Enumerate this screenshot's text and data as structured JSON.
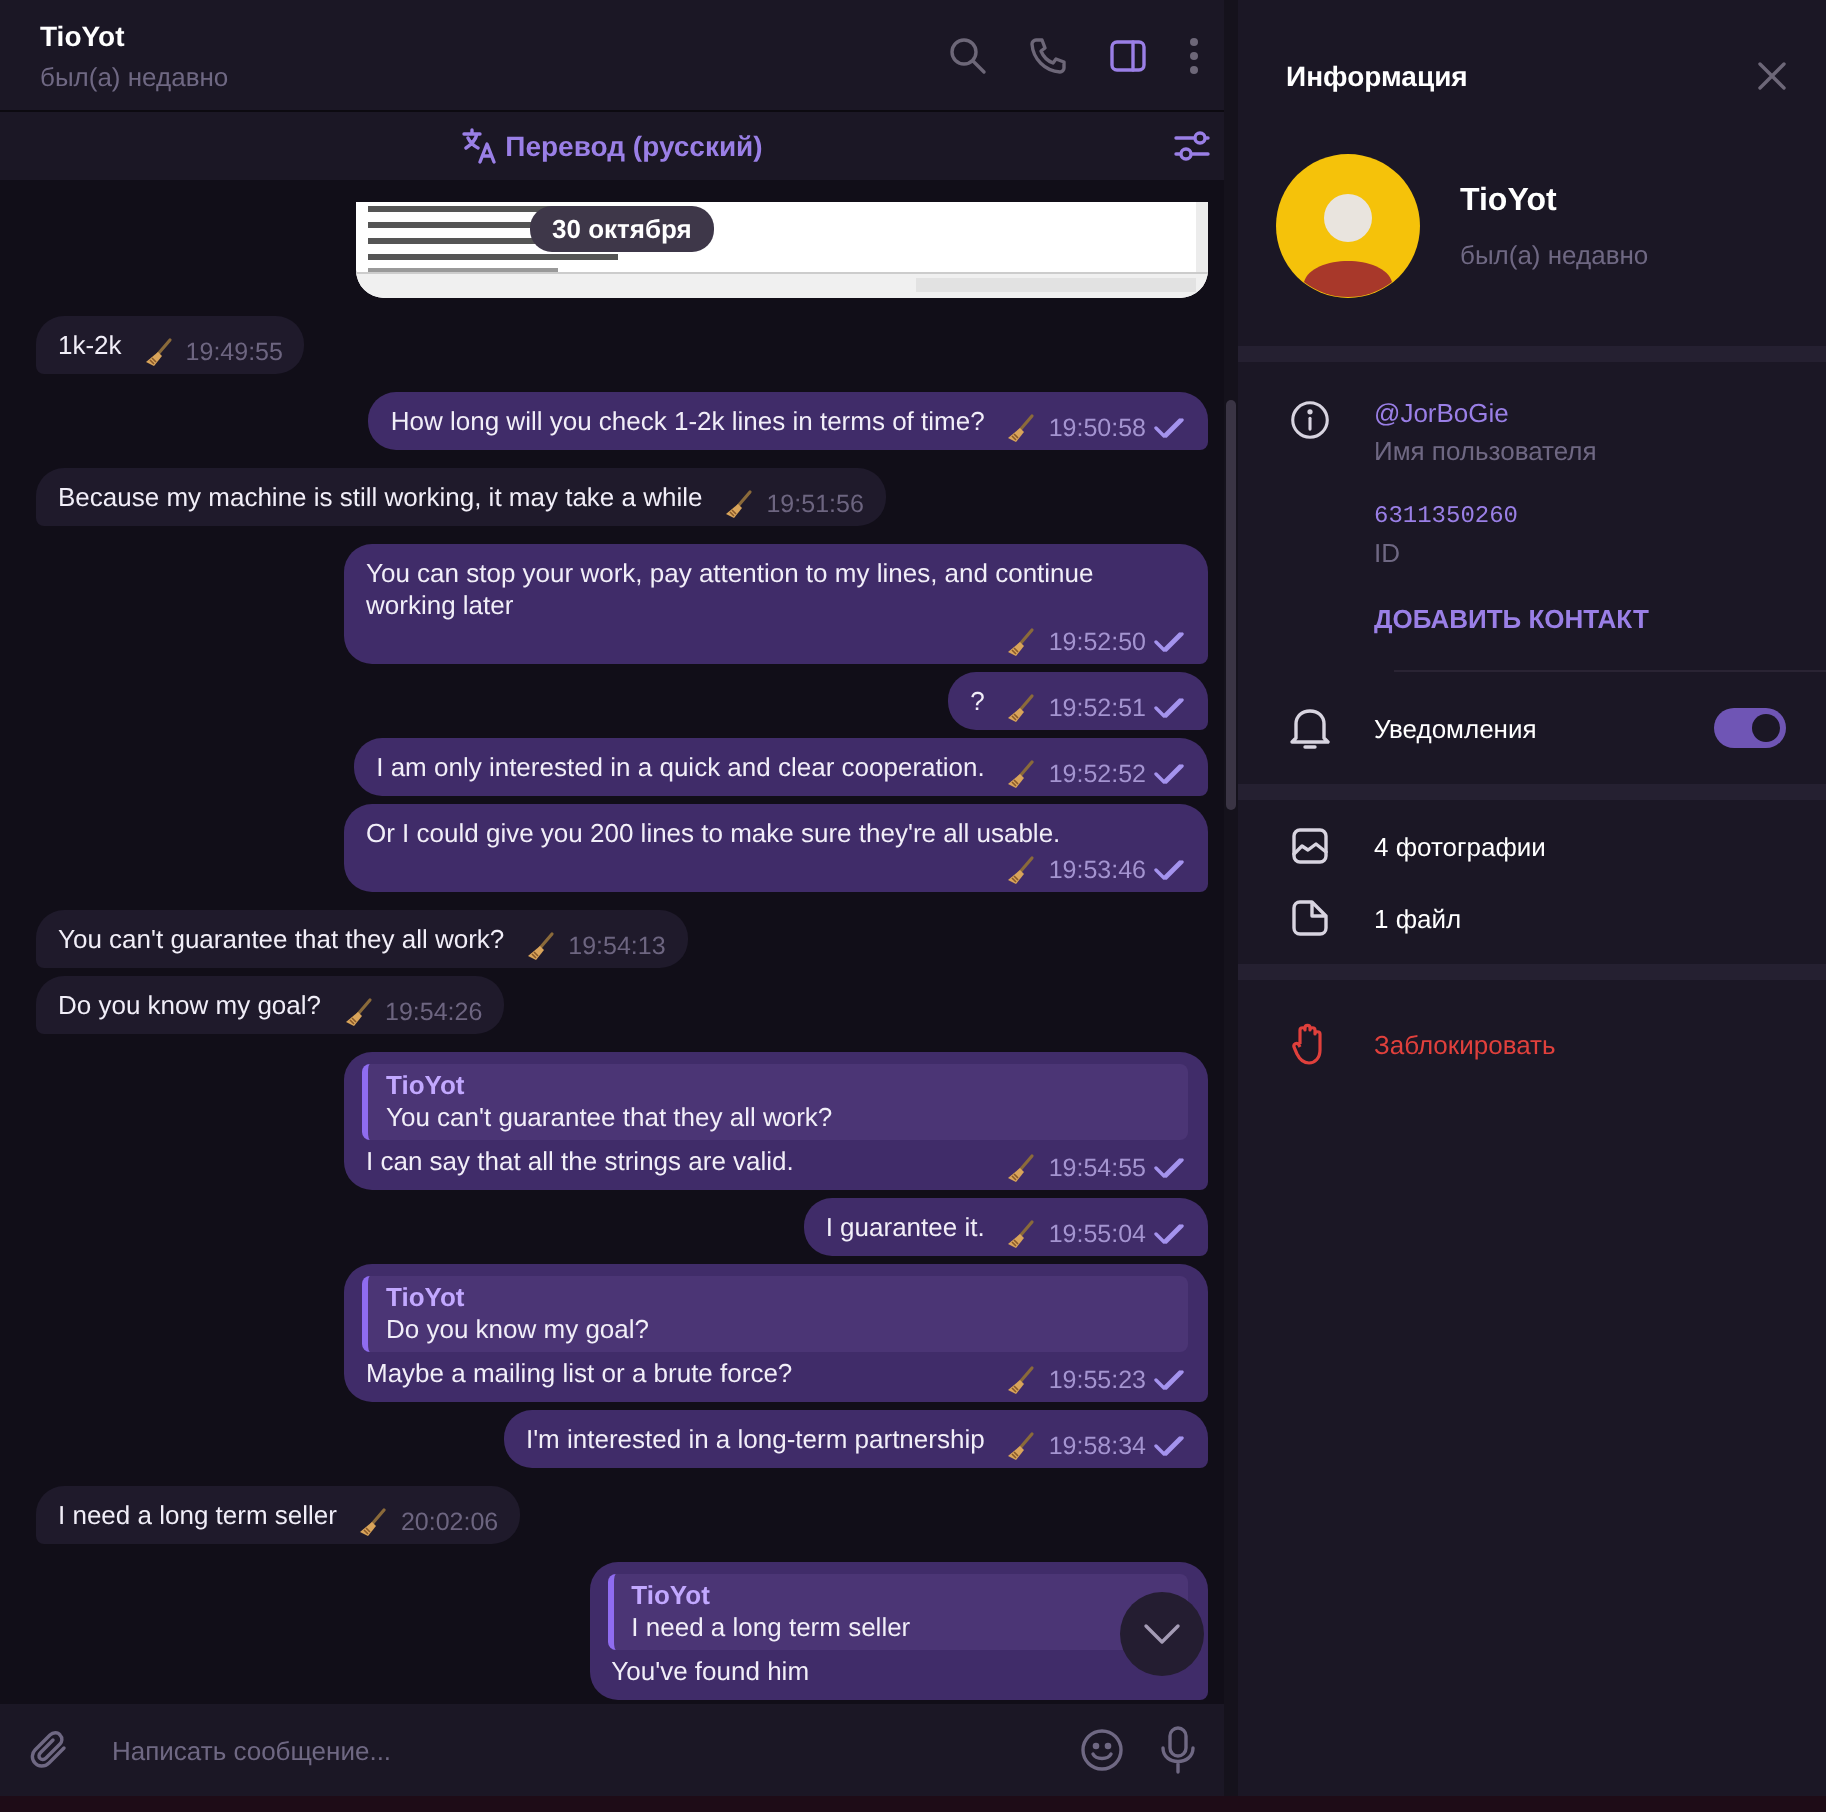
{
  "chat_header": {
    "title": "TioYot",
    "status": "был(а) недавно",
    "panel_toggle_on": true
  },
  "translate_bar": {
    "label": "Перевод (русский)"
  },
  "date_pill": "30 октября",
  "messages": [
    {
      "kind": "picture",
      "outgoing": true
    },
    {
      "kind": "text",
      "outgoing": false,
      "text": "1k-2k",
      "time": "19:49:55"
    },
    {
      "kind": "text",
      "outgoing": true,
      "text": "How long will you check 1-2k lines in terms of time?",
      "time": "19:50:58",
      "read": true
    },
    {
      "kind": "text",
      "outgoing": false,
      "text": "Because my machine is still working, it may take a while",
      "time": "19:51:56"
    },
    {
      "kind": "text",
      "outgoing": true,
      "text": "You can stop your work, pay attention to my lines, and continue working later",
      "time": "19:52:50",
      "read": true
    },
    {
      "kind": "text",
      "outgoing": true,
      "text": "?",
      "time": "19:52:51",
      "read": true
    },
    {
      "kind": "text",
      "outgoing": true,
      "text": "I am only interested in a quick and clear cooperation.",
      "time": "19:52:52",
      "read": true
    },
    {
      "kind": "text",
      "outgoing": true,
      "text": "Or I could give you 200 lines to make sure they're all usable.",
      "time": "19:53:46",
      "read": true
    },
    {
      "kind": "text",
      "outgoing": false,
      "text": "You can't guarantee that they all work?",
      "time": "19:54:13"
    },
    {
      "kind": "text",
      "outgoing": false,
      "text": "Do you know my goal?",
      "time": "19:54:26"
    },
    {
      "kind": "reply",
      "outgoing": true,
      "reply": {
        "name": "TioYot",
        "text": "You can't guarantee that they all work?"
      },
      "text": "I can say that all the strings are valid.",
      "time": "19:54:55",
      "read": true
    },
    {
      "kind": "text",
      "outgoing": true,
      "text": "I guarantee it.",
      "time": "19:55:04",
      "read": true
    },
    {
      "kind": "reply",
      "outgoing": true,
      "reply": {
        "name": "TioYot",
        "text": "Do you know my goal?"
      },
      "text": "Maybe a mailing list or a brute force?",
      "time": "19:55:23",
      "read": true
    },
    {
      "kind": "text",
      "outgoing": true,
      "text": "I'm interested in a long-term partnership",
      "time": "19:58:34",
      "read": true
    },
    {
      "kind": "text",
      "outgoing": false,
      "text": "I need a long term seller",
      "time": "20:02:06"
    },
    {
      "kind": "reply",
      "outgoing": true,
      "reply": {
        "name": "TioYot",
        "text": "I need a long term seller"
      },
      "text": "You've found him"
    }
  ],
  "composer": {
    "placeholder": "Написать сообщение..."
  },
  "info_panel": {
    "title": "Информация",
    "name": "TioYot",
    "status": "был(а) недавно",
    "username": "@JorBoGie",
    "username_label": "Имя пользователя",
    "id": "6311350260",
    "id_label": "ID",
    "add_contact": "ДОБАВИТЬ КОНТАКТ",
    "notifications": {
      "label": "Уведомления",
      "on": true
    },
    "media": [
      {
        "kind": "photos",
        "label": "4 фотографии"
      },
      {
        "kind": "files",
        "label": "1 файл"
      }
    ],
    "block": "Заблокировать"
  }
}
